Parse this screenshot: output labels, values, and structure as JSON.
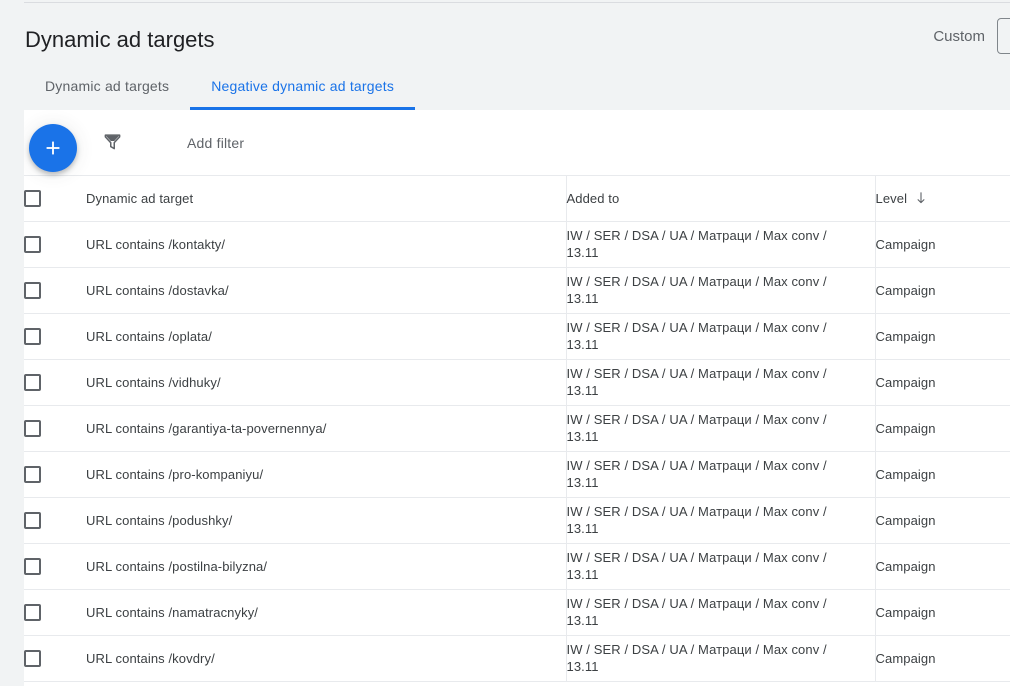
{
  "header": {
    "title": "Dynamic ad targets",
    "date_range_label": "Custom"
  },
  "tabs": [
    {
      "label": "Dynamic ad targets",
      "active": false
    },
    {
      "label": "Negative dynamic ad targets",
      "active": true
    }
  ],
  "toolbar": {
    "add_button_icon": "plus-icon",
    "filter_icon": "filter-funnel-icon",
    "add_filter_label": "Add filter"
  },
  "table": {
    "columns": [
      {
        "key": "select",
        "label": ""
      },
      {
        "key": "target",
        "label": "Dynamic ad target"
      },
      {
        "key": "added_to",
        "label": "Added to"
      },
      {
        "key": "level",
        "label": "Level",
        "sorted": "descending",
        "sort_glyph": "↓"
      }
    ],
    "rows": [
      {
        "target": "URL contains /kontakty/",
        "added_to": "IW / SER / DSA / UA / Матраци / Max conv / 13.11",
        "level": "Campaign"
      },
      {
        "target": "URL contains /dostavka/",
        "added_to": "IW / SER / DSA / UA / Матраци / Max conv / 13.11",
        "level": "Campaign"
      },
      {
        "target": "URL contains /oplata/",
        "added_to": "IW / SER / DSA / UA / Матраци / Max conv / 13.11",
        "level": "Campaign"
      },
      {
        "target": "URL contains /vidhuky/",
        "added_to": "IW / SER / DSA / UA / Матраци / Max conv / 13.11",
        "level": "Campaign"
      },
      {
        "target": "URL contains /garantiya-ta-povernennya/",
        "added_to": "IW / SER / DSA / UA / Матраци / Max conv / 13.11",
        "level": "Campaign"
      },
      {
        "target": "URL contains /pro-kompaniyu/",
        "added_to": "IW / SER / DSA / UA / Матраци / Max conv / 13.11",
        "level": "Campaign"
      },
      {
        "target": "URL contains /podushky/",
        "added_to": "IW / SER / DSA / UA / Матраци / Max conv / 13.11",
        "level": "Campaign"
      },
      {
        "target": "URL contains /postilna-bilyzna/",
        "added_to": "IW / SER / DSA / UA / Матраци / Max conv / 13.11",
        "level": "Campaign"
      },
      {
        "target": "URL contains /namatracnyky/",
        "added_to": "IW / SER / DSA / UA / Матраци / Max conv / 13.11",
        "level": "Campaign"
      },
      {
        "target": "URL contains /kovdry/",
        "added_to": "IW / SER / DSA / UA / Матраци / Max conv / 13.11",
        "level": "Campaign"
      }
    ]
  },
  "colors": {
    "accent": "#1a73e8",
    "page_background": "#f1f3f4",
    "card_background": "#ffffff",
    "text_primary": "#3c4043",
    "text_secondary": "#5f6368",
    "divider": "#e8eaed"
  }
}
